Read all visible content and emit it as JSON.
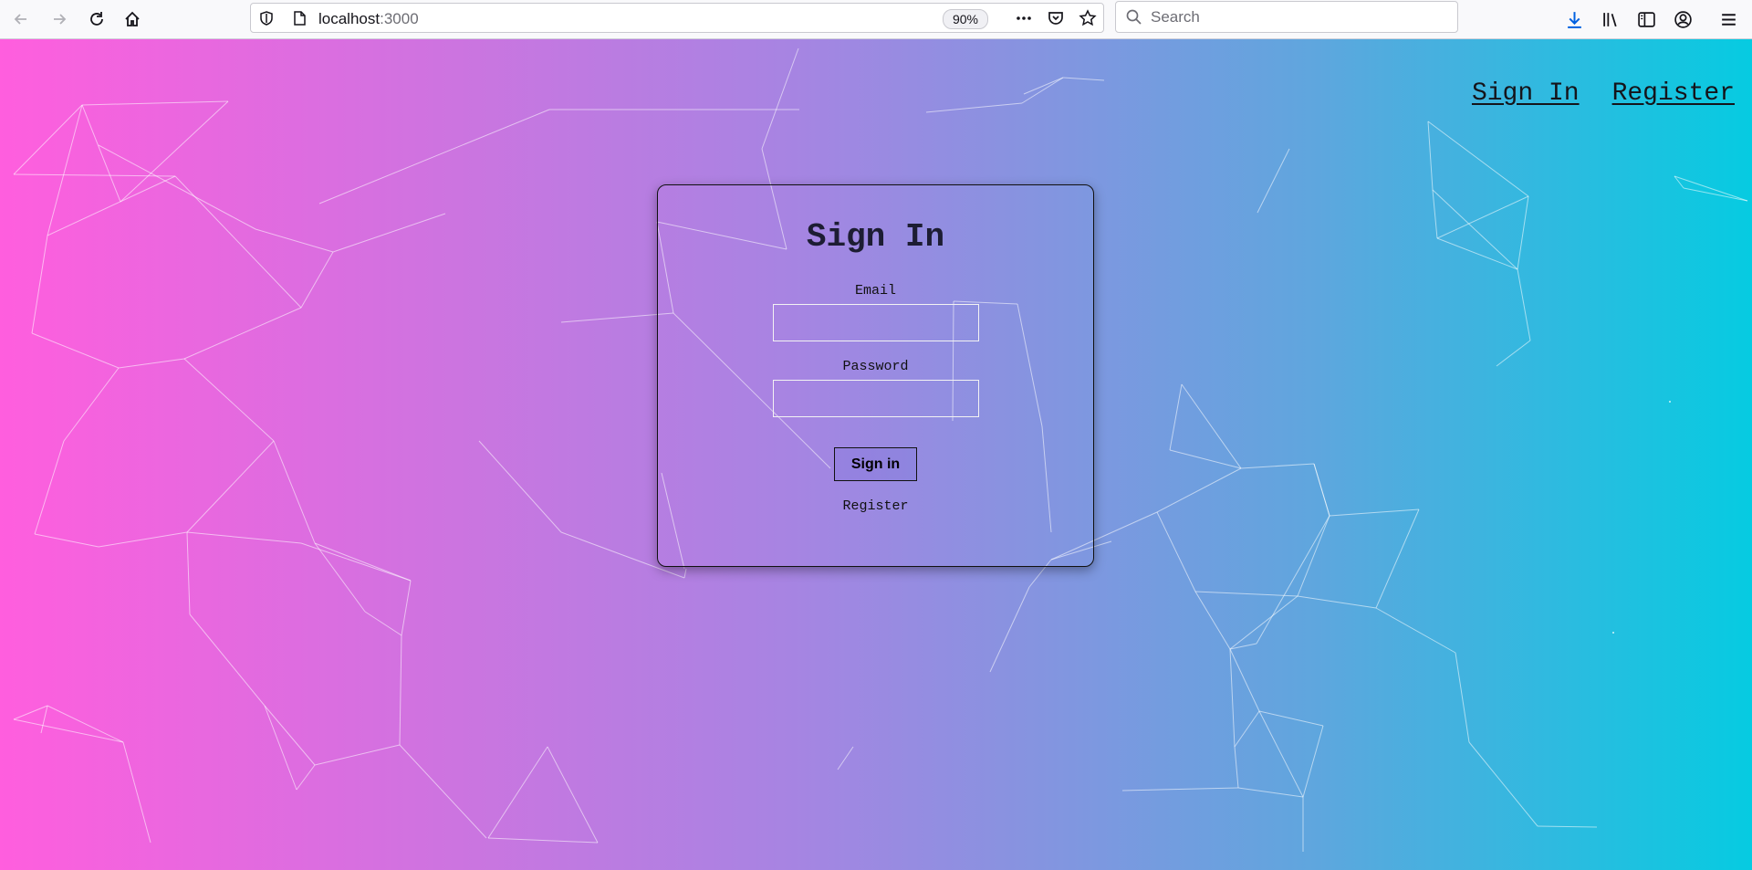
{
  "browser": {
    "url_host": "localhost",
    "url_port": ":3000",
    "zoom": "90%",
    "search_placeholder": "Search"
  },
  "nav": {
    "sign_in": "Sign In",
    "register": "Register"
  },
  "form": {
    "title": "Sign In",
    "email_label": "Email",
    "email_value": "",
    "password_label": "Password",
    "password_value": "",
    "submit_label": "Sign in",
    "register_link": "Register"
  },
  "colors": {
    "gradient_left": "#ff5ede",
    "gradient_mid": "#a784e2",
    "gradient_right": "#06cbe1"
  }
}
